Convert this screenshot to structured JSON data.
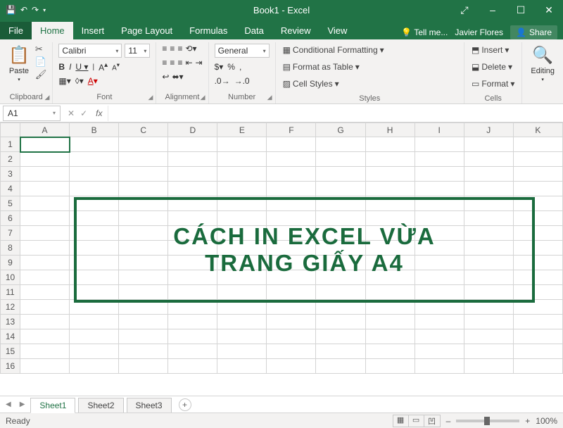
{
  "title": "Book1 - Excel",
  "qa": {
    "save": "💾",
    "undo": "↶",
    "redo": "↷"
  },
  "wbtns": {
    "min": "–",
    "max": "☐",
    "close": "✕",
    "ribmin": "⤢"
  },
  "tabs": [
    "File",
    "Home",
    "Insert",
    "Page Layout",
    "Formulas",
    "Data",
    "Review",
    "View"
  ],
  "tell": "Tell me...",
  "user": "Javier Flores",
  "share": "Share",
  "groups": {
    "clipboard": "Clipboard",
    "font": "Font",
    "alignment": "Alignment",
    "number": "Number",
    "styles": "Styles",
    "cells": "Cells",
    "editing": "Editing"
  },
  "font": {
    "name": "Calibri",
    "size": "11"
  },
  "numfmt": "General",
  "styles": {
    "cf": "Conditional Formatting",
    "tbl": "Format as Table",
    "cs": "Cell Styles"
  },
  "cells": {
    "ins": "Insert",
    "del": "Delete",
    "fmt": "Format"
  },
  "namebox": "A1",
  "cols": [
    "A",
    "B",
    "C",
    "D",
    "E",
    "F",
    "G",
    "H",
    "I",
    "J",
    "K"
  ],
  "rows": [
    1,
    2,
    3,
    4,
    5,
    6,
    7,
    8,
    9,
    10,
    11,
    12,
    13,
    14,
    15,
    16
  ],
  "overlay": {
    "line1": "CÁCH IN EXCEL VỪA",
    "line2": "TRANG GIẤY A4"
  },
  "sheets": [
    "Sheet1",
    "Sheet2",
    "Sheet3"
  ],
  "status": "Ready",
  "zoom": "100%"
}
